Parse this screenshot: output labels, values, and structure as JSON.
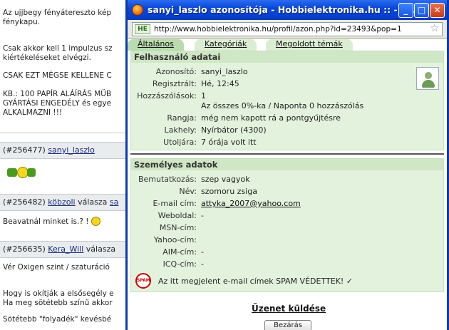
{
  "background": {
    "block1": [
      "Az ujjbegy fényátereszto kép",
      "fénykapu."
    ],
    "block2": [
      "Csak akkor kell 1 impulzus sz",
      "kiértékeléseket elvégzi."
    ],
    "block3": [
      "CSAK EZT MÉGSE KELLENE C"
    ],
    "block4": [
      "KB.: 100 PAPÍR ALÁÍRÁS MŰB",
      "GYÁRTÁSI ENGEDÉLY és egye",
      "ALKALMAZNI !!!"
    ],
    "post1": {
      "id": "(#256477)",
      "author": "sanyi_laszlo"
    },
    "post2": {
      "id": "(#256482)",
      "author": "köbzoli",
      "suffix": "válasza",
      "target": "sa"
    },
    "post2_text": "Beavatnál minket is.? !",
    "post3": {
      "id": "(#256635)",
      "author": "Kera_Will",
      "suffix": "válasza"
    },
    "post3_text": "Vér Oxigen szint / szaturáció",
    "block5": [
      "Hogy is okítják a elsősegély e",
      "Ha meg sötétebb színű akkor"
    ],
    "block6": [
      "Sötétebb \"folyadék\" kevésbé"
    ]
  },
  "window": {
    "title": "sanyi_laszlo azonosítója - Hobbielektronika.hu :: - M...",
    "min_glyph": "_",
    "max_glyph": "□",
    "close_glyph": "✕",
    "identity_badge": "HE",
    "url": "http://www.hobbielektronika.hu/profil/azon.php?id=23493&pop=1",
    "star_glyph": "☆"
  },
  "tabs": [
    {
      "label": "Általános"
    },
    {
      "label": "Kategóriák"
    },
    {
      "label": "Megoldott témák"
    }
  ],
  "user_data": {
    "heading": "Felhasználó adatai",
    "rows": [
      {
        "label": "Azonosító:",
        "value": "sanyi_laszlo"
      },
      {
        "label": "Regisztrált:",
        "value": "Hé, 12:45"
      },
      {
        "label": "Hozzászólások:",
        "value": "1"
      },
      {
        "label": "",
        "value": "Az összes 0%-ka / Naponta 0 hozzászólás"
      },
      {
        "label": "Rangja:",
        "value": "még nem kapott rá a pontgyűjtésre"
      },
      {
        "label": "Lakhely:",
        "value": "Nyírbátor (4300)"
      },
      {
        "label": "Utoljára:",
        "value": "7 órája volt itt"
      }
    ]
  },
  "personal": {
    "heading": "Személyes adatok",
    "rows": [
      {
        "label": "Bemutatkozás:",
        "value": "szep vagyok"
      },
      {
        "label": "Név:",
        "value": "szomoru zsiga"
      },
      {
        "label": "E-mail cím:",
        "value": "attyka_2007@yahoo.com"
      },
      {
        "label": "Weboldal:",
        "value": "-"
      },
      {
        "label": "MSN-cím:",
        "value": ""
      },
      {
        "label": "Yahoo-cím:",
        "value": ""
      },
      {
        "label": "AIM-cím:",
        "value": "-"
      },
      {
        "label": "ICQ-cím:",
        "value": "-"
      }
    ],
    "spam_badge": "SPAM",
    "spam_notice": "Az itt megjelent e-mail címek SPAM VÉDETTEK! ✓"
  },
  "send_message": "Üzenet küldése",
  "bottom_button": "Bezárás",
  "colors": {
    "titlebar": "#0a47d8",
    "section_bg": "#e3f2dd",
    "tab_active": "#b9dcae"
  }
}
